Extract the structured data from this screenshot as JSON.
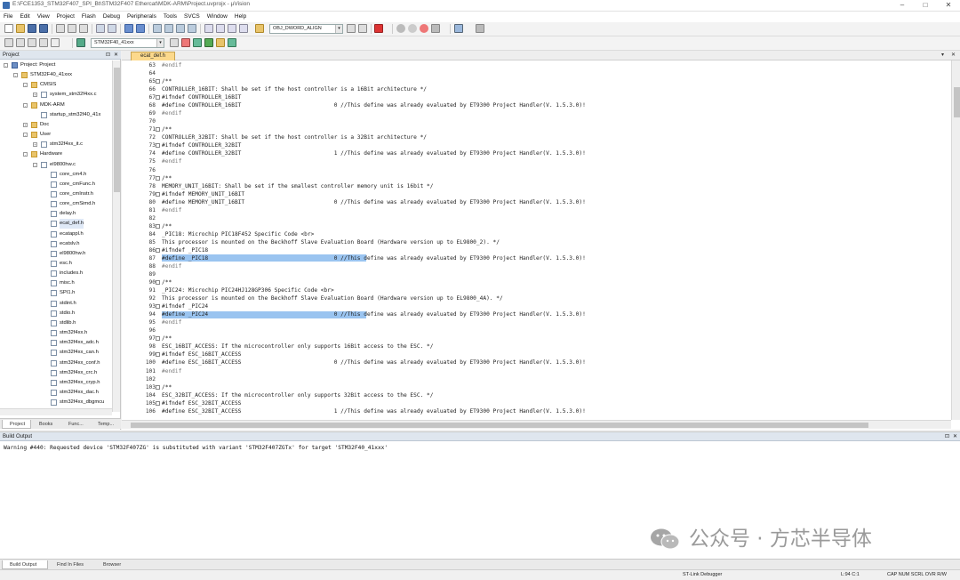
{
  "window": {
    "title": "E:\\FCE1353_STM32F407_SPI_Bt\\STM32F407 Ethercat\\MDK-ARM\\Project.uvprojx - µVision",
    "controls": [
      "–",
      "□",
      "✕"
    ]
  },
  "menu": [
    "File",
    "Edit",
    "View",
    "Project",
    "Flash",
    "Debug",
    "Peripherals",
    "Tools",
    "SVCS",
    "Window",
    "Help"
  ],
  "toolbar": {
    "find_combo": "OBJ_DWORD_ALIGN",
    "target_combo": "STM32F40_41xxx"
  },
  "project_panel": {
    "title": "Project",
    "tree": [
      {
        "label": "Project: Project",
        "level": 0,
        "kind": "proj",
        "exp": "-"
      },
      {
        "label": "STM32F40_41xxx",
        "level": 1,
        "kind": "folder",
        "exp": "-"
      },
      {
        "label": "CMSIS",
        "level": 2,
        "kind": "folder",
        "exp": "-"
      },
      {
        "label": "system_stm32f4xx.c",
        "level": 3,
        "kind": "file",
        "exp": "+"
      },
      {
        "label": "MDK-ARM",
        "level": 2,
        "kind": "folder",
        "exp": "-"
      },
      {
        "label": "startup_stm32f40_41x",
        "level": 3,
        "kind": "file",
        "exp": ""
      },
      {
        "label": "Doc",
        "level": 2,
        "kind": "folder",
        "exp": "+"
      },
      {
        "label": "User",
        "level": 2,
        "kind": "folder",
        "exp": "-"
      },
      {
        "label": "stm32f4xx_it.c",
        "level": 3,
        "kind": "file",
        "exp": "+"
      },
      {
        "label": "Hardware",
        "level": 2,
        "kind": "folder",
        "exp": "-"
      },
      {
        "label": "el9800hw.c",
        "level": 3,
        "kind": "file",
        "exp": "-"
      },
      {
        "label": "core_cm4.h",
        "level": 4,
        "kind": "file",
        "exp": ""
      },
      {
        "label": "core_cmFunc.h",
        "level": 4,
        "kind": "file",
        "exp": ""
      },
      {
        "label": "core_cmInstr.h",
        "level": 4,
        "kind": "file",
        "exp": ""
      },
      {
        "label": "core_cmSimd.h",
        "level": 4,
        "kind": "file",
        "exp": ""
      },
      {
        "label": "delay.h",
        "level": 4,
        "kind": "file",
        "exp": ""
      },
      {
        "label": "ecat_def.h",
        "level": 4,
        "kind": "file",
        "exp": ""
      },
      {
        "label": "ecatappl.h",
        "level": 4,
        "kind": "file",
        "exp": ""
      },
      {
        "label": "ecatslv.h",
        "level": 4,
        "kind": "file",
        "exp": ""
      },
      {
        "label": "el9800hw.h",
        "level": 4,
        "kind": "file",
        "exp": ""
      },
      {
        "label": "esc.h",
        "level": 4,
        "kind": "file",
        "exp": ""
      },
      {
        "label": "includes.h",
        "level": 4,
        "kind": "file",
        "exp": ""
      },
      {
        "label": "misc.h",
        "level": 4,
        "kind": "file",
        "exp": ""
      },
      {
        "label": "SPI1.h",
        "level": 4,
        "kind": "file",
        "exp": ""
      },
      {
        "label": "stdint.h",
        "level": 4,
        "kind": "file",
        "exp": ""
      },
      {
        "label": "stdio.h",
        "level": 4,
        "kind": "file",
        "exp": ""
      },
      {
        "label": "stdlib.h",
        "level": 4,
        "kind": "file",
        "exp": ""
      },
      {
        "label": "stm32f4xx.h",
        "level": 4,
        "kind": "file",
        "exp": ""
      },
      {
        "label": "stm32f4xx_adc.h",
        "level": 4,
        "kind": "file",
        "exp": ""
      },
      {
        "label": "stm32f4xx_can.h",
        "level": 4,
        "kind": "file",
        "exp": ""
      },
      {
        "label": "stm32f4xx_conf.h",
        "level": 4,
        "kind": "file",
        "exp": ""
      },
      {
        "label": "stm32f4xx_crc.h",
        "level": 4,
        "kind": "file",
        "exp": ""
      },
      {
        "label": "stm32f4xx_cryp.h",
        "level": 4,
        "kind": "file",
        "exp": ""
      },
      {
        "label": "stm32f4xx_dac.h",
        "level": 4,
        "kind": "file",
        "exp": ""
      },
      {
        "label": "stm32f4xx_dbgmcu",
        "level": 4,
        "kind": "file",
        "exp": ""
      }
    ],
    "bottom_tabs": [
      "Project",
      "Books",
      "Func...",
      "Temp..."
    ]
  },
  "editor": {
    "active_tab": "ecat_def.h",
    "lines": [
      {
        "n": "63",
        "text": "#endif",
        "dim": true
      },
      {
        "n": "64",
        "text": ""
      },
      {
        "n": "65",
        "text": "/**",
        "fold": true
      },
      {
        "n": "66",
        "text": "CONTROLLER_16BIT: Shall be set if the host controller is a 16Bit architecture */"
      },
      {
        "n": "67",
        "text": "#ifndef CONTROLLER_16BIT",
        "fold": true
      },
      {
        "n": "68",
        "text": "#define CONTROLLER_16BIT                            0 //This define was already evaluated by ET9300 Project Handler(V. 1.5.3.0)!"
      },
      {
        "n": "69",
        "text": "#endif",
        "dim": true
      },
      {
        "n": "70",
        "text": ""
      },
      {
        "n": "71",
        "text": "/**",
        "fold": true
      },
      {
        "n": "72",
        "text": "CONTROLLER_32BIT: Shall be set if the host controller is a 32Bit architecture */"
      },
      {
        "n": "73",
        "text": "#ifndef CONTROLLER_32BIT",
        "fold": true
      },
      {
        "n": "74",
        "text": "#define CONTROLLER_32BIT                            1 //This define was already evaluated by ET9300 Project Handler(V. 1.5.3.0)!"
      },
      {
        "n": "75",
        "text": "#endif",
        "dim": true
      },
      {
        "n": "76",
        "text": ""
      },
      {
        "n": "77",
        "text": "/**",
        "fold": true
      },
      {
        "n": "78",
        "text": "MEMORY_UNIT_16BIT: Shall be set if the smallest controller memory unit is 16bit */"
      },
      {
        "n": "79",
        "text": "#ifndef MEMORY_UNIT_16BIT",
        "fold": true
      },
      {
        "n": "80",
        "text": "#define MEMORY_UNIT_16BIT                           0 //This define was already evaluated by ET9300 Project Handler(V. 1.5.3.0)!"
      },
      {
        "n": "81",
        "text": "#endif",
        "dim": true
      },
      {
        "n": "82",
        "text": ""
      },
      {
        "n": "83",
        "text": "/**",
        "fold": true
      },
      {
        "n": "84",
        "text": "_PIC18: Microchip PIC18F452 Specific Code <br>"
      },
      {
        "n": "85",
        "text": "This processor is mounted on the Beckhoff Slave Evaluation Board (Hardware version up to EL9800_2). */"
      },
      {
        "n": "86",
        "text": "#ifndef _PIC18",
        "fold": true
      },
      {
        "n": "87",
        "text": "#define _PIC18                                      0 //This define was already evaluated by ET9300 Project Handler(V. 1.5.3.0)!",
        "hl": true
      },
      {
        "n": "88",
        "text": "#endif",
        "dim": true
      },
      {
        "n": "89",
        "text": ""
      },
      {
        "n": "90",
        "text": "/**",
        "fold": true
      },
      {
        "n": "91",
        "text": "_PIC24: Microchip PIC24HJ128GP306 Specific Code <br>"
      },
      {
        "n": "92",
        "text": "This processor is mounted on the Beckhoff Slave Evaluation Board (Hardware version up to EL9800_4A). */"
      },
      {
        "n": "93",
        "text": "#ifndef _PIC24",
        "fold": true
      },
      {
        "n": "94",
        "text": "#define _PIC24                                      0 //This define was already evaluated by ET9300 Project Handler(V. 1.5.3.0)!",
        "hl": true
      },
      {
        "n": "95",
        "text": "#endif",
        "dim": true
      },
      {
        "n": "96",
        "text": ""
      },
      {
        "n": "97",
        "text": "/**",
        "fold": true
      },
      {
        "n": "98",
        "text": "ESC_16BIT_ACCESS: If the microcontroller only supports 16Bit access to the ESC. */"
      },
      {
        "n": "99",
        "text": "#ifndef ESC_16BIT_ACCESS",
        "fold": true
      },
      {
        "n": "100",
        "text": "#define ESC_16BIT_ACCESS                            0 //This define was already evaluated by ET9300 Project Handler(V. 1.5.3.0)!"
      },
      {
        "n": "101",
        "text": "#endif",
        "dim": true
      },
      {
        "n": "102",
        "text": ""
      },
      {
        "n": "103",
        "text": "/**",
        "fold": true
      },
      {
        "n": "104",
        "text": "ESC_32BIT_ACCESS: If the microcontroller only supports 32Bit access to the ESC. */"
      },
      {
        "n": "105",
        "text": "#ifndef ESC_32BIT_ACCESS",
        "fold": true
      },
      {
        "n": "106",
        "text": "#define ESC_32BIT_ACCESS                            1 //This define was already evaluated by ET9300 Project Handler(V. 1.5.3.0)!"
      }
    ]
  },
  "build_output": {
    "title": "Build Output",
    "message": "Warning #440: Requested device 'STM32F407ZG' is substituted with variant 'STM32F407ZGTx' for target 'STM32F40_41xxx'",
    "bottom_tabs": [
      "Build Output",
      "Find In Files",
      "Browser"
    ]
  },
  "status": {
    "debugger": "ST-Link Debugger",
    "position": "L:94 C:1",
    "indicators": "CAP  NUM  SCRL  OVR  R/W"
  },
  "watermark": {
    "text": "公众号 · 方芯半导体"
  }
}
